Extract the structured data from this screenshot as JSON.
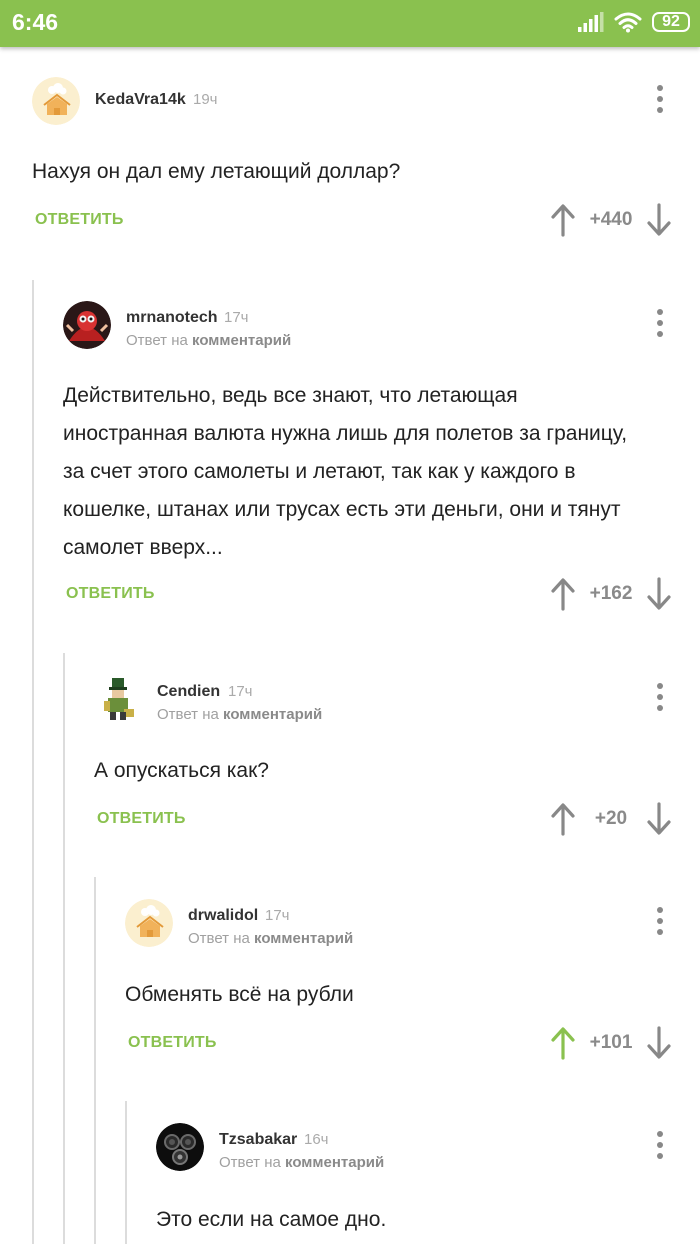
{
  "status_bar": {
    "time": "6:46",
    "battery": "92"
  },
  "colors": {
    "accent": "#8ac14f",
    "muted": "#8a8a8a",
    "thread_line": "#dcdcdc"
  },
  "reply_prefix": "Ответ на",
  "reply_target": "комментарий",
  "reply_label": "ОТВЕТИТЬ",
  "comments": [
    {
      "user": "KedaVra14k",
      "time": "19ч",
      "text": "Нахуя он дал ему летающий доллар?",
      "rating": "+440",
      "avatar_icon": "pikabu-default-avatar-icon",
      "upvoted": false
    },
    {
      "user": "mrnanotech",
      "time": "17ч",
      "text": "Действительно, ведь все знают, что летающая иностранная валюта нужна лишь для полетов за границу, за счет этого самолеты и летают, так как у каждого в кошелке, штанах или трусах есть эти деньги, они и тянут самолет вверх...",
      "rating": "+162",
      "avatar_icon": "red-character-avatar-icon",
      "upvoted": false
    },
    {
      "user": "Cendien",
      "time": "17ч",
      "text": "А опускаться как?",
      "rating": "+20",
      "avatar_icon": "pixel-character-avatar-icon",
      "upvoted": false
    },
    {
      "user": "drwalidol",
      "time": "17ч",
      "text": "Обменять всё на рубли",
      "rating": "+101",
      "avatar_icon": "pikabu-default-avatar-icon",
      "upvoted": true
    },
    {
      "user": "Tzsabakar",
      "time": "16ч",
      "text": "Это если на самое дно.",
      "rating": "",
      "avatar_icon": "gas-mask-avatar-icon",
      "upvoted": false
    }
  ]
}
